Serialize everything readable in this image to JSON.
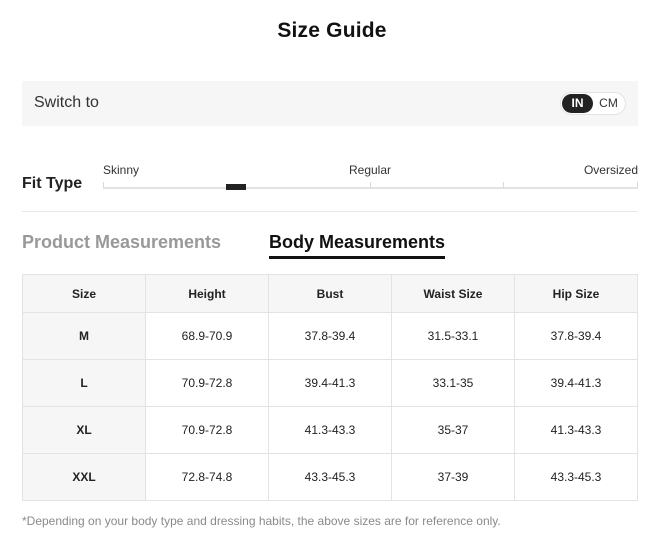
{
  "title": "Size Guide",
  "switch": {
    "label": "Switch to",
    "options": [
      "IN",
      "CM"
    ],
    "selected": "IN"
  },
  "fit": {
    "label": "Fit Type",
    "scale": [
      "Skinny",
      "Regular",
      "Oversized"
    ],
    "marker_position_fraction": 0.25
  },
  "tabs": [
    {
      "label": "Product Measurements",
      "active": false
    },
    {
      "label": "Body Measurements",
      "active": true
    }
  ],
  "table": {
    "headers": [
      "Size",
      "Height",
      "Bust",
      "Waist Size",
      "Hip Size"
    ],
    "rows": [
      [
        "M",
        "68.9-70.9",
        "37.8-39.4",
        "31.5-33.1",
        "37.8-39.4"
      ],
      [
        "L",
        "70.9-72.8",
        "39.4-41.3",
        "33.1-35",
        "39.4-41.3"
      ],
      [
        "XL",
        "70.9-72.8",
        "41.3-43.3",
        "35-37",
        "41.3-43.3"
      ],
      [
        "XXL",
        "72.8-74.8",
        "43.3-45.3",
        "37-39",
        "43.3-45.3"
      ]
    ]
  },
  "footnote": "*Depending on your body type and dressing habits, the above sizes are for reference only."
}
